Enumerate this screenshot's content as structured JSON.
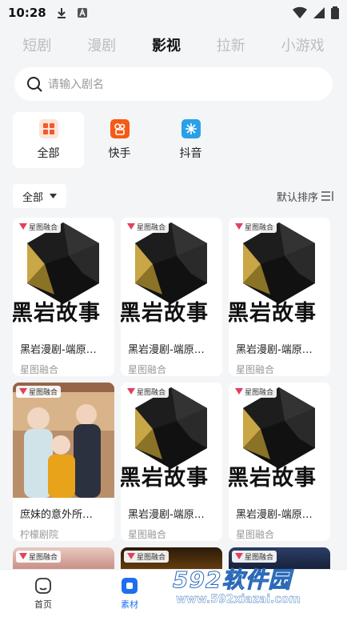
{
  "status": {
    "time": "10:28"
  },
  "tabs": [
    {
      "label": "短剧",
      "active": false
    },
    {
      "label": "漫剧",
      "active": false
    },
    {
      "label": "影视",
      "active": true
    },
    {
      "label": "拉新",
      "active": false
    },
    {
      "label": "小游戏",
      "active": false
    }
  ],
  "search": {
    "placeholder": "请输入剧名"
  },
  "sources": [
    {
      "label": "全部",
      "icon": "grid-icon",
      "color": "#f0592b"
    },
    {
      "label": "快手",
      "icon": "kuaishou-icon",
      "color": "#f65a17"
    },
    {
      "label": "抖音",
      "icon": "douyin-icon",
      "color": "#2aa0e8"
    }
  ],
  "filter": {
    "selected": "全部",
    "sort_label": "默认排序"
  },
  "cards": [
    {
      "tag": "星图融合",
      "title": "黑岩漫剧-端原…",
      "source": "星图融合",
      "poster_text": "黑岩故事",
      "poster": "blackrock"
    },
    {
      "tag": "星图融合",
      "title": "黑岩漫剧-端原…",
      "source": "星图融合",
      "poster_text": "黑岩故事",
      "poster": "blackrock"
    },
    {
      "tag": "星图融合",
      "title": "黑岩漫剧-端原…",
      "source": "星图融合",
      "poster_text": "黑岩故事",
      "poster": "blackrock"
    },
    {
      "tag": "星图融合",
      "title": "庶妹的意外所…",
      "source": "柠檬剧院",
      "poster_text": "",
      "poster": "drama"
    },
    {
      "tag": "星图融合",
      "title": "黑岩漫剧-端原…",
      "source": "星图融合",
      "poster_text": "黑岩故事",
      "poster": "blackrock"
    },
    {
      "tag": "星图融合",
      "title": "黑岩漫剧-端原…",
      "source": "星图融合",
      "poster_text": "黑岩故事",
      "poster": "blackrock"
    }
  ],
  "partial_tags": [
    "星图融合",
    "星图融合",
    "星图融合"
  ],
  "bottom_nav": [
    {
      "label": "首页",
      "active": false
    },
    {
      "label": "素材",
      "active": true
    }
  ],
  "watermark": {
    "main": "592软件园",
    "url": "www.592xiazai.com"
  },
  "colors": {
    "accent": "#1e6ff0"
  }
}
